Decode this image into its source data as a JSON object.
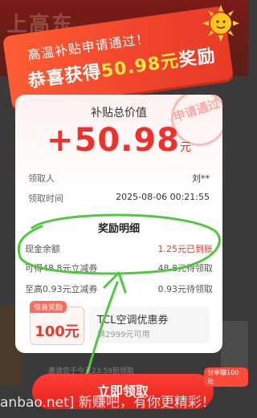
{
  "background": {
    "top_text": "上高东",
    "bottom_hint": "邀请您于今天23:59前领取"
  },
  "ribbon": {
    "line1": "高温补贴申请通过！",
    "line2_prefix": "恭喜获得",
    "line2_amount": "50.98元",
    "line2_suffix": "奖励"
  },
  "card": {
    "title": "补贴总价值",
    "amount": "+50.98",
    "amount_unit": "元",
    "stamp": "申请通过",
    "rows": [
      {
        "label": "领取人",
        "value": "刘**"
      },
      {
        "label": "领取时间",
        "value": "2025-08-06 00:21:55"
      }
    ],
    "reward_title": "奖励明细",
    "rewards": [
      {
        "label": "现金余额",
        "value": "1.25元已到账"
      },
      {
        "label": "可得48.8元立减券",
        "value": "48.8元待领取"
      },
      {
        "label": "至高0.93元立减券",
        "value": "0.93元待领取"
      }
    ],
    "coupon_a": {
      "tag": "惊喜奖励",
      "value": "100元"
    },
    "coupon_b": {
      "title": "TCL空调优惠券",
      "sub": "满2999元可用"
    }
  },
  "claim_button": "立即领取",
  "badge_right": "分享赚100元",
  "watermark": "anbao.net] 新赚吧，有你更精彩！",
  "colors": {
    "accent": "#f0302a",
    "ribbon": "#f0442c",
    "annotation": "#4fc840"
  }
}
